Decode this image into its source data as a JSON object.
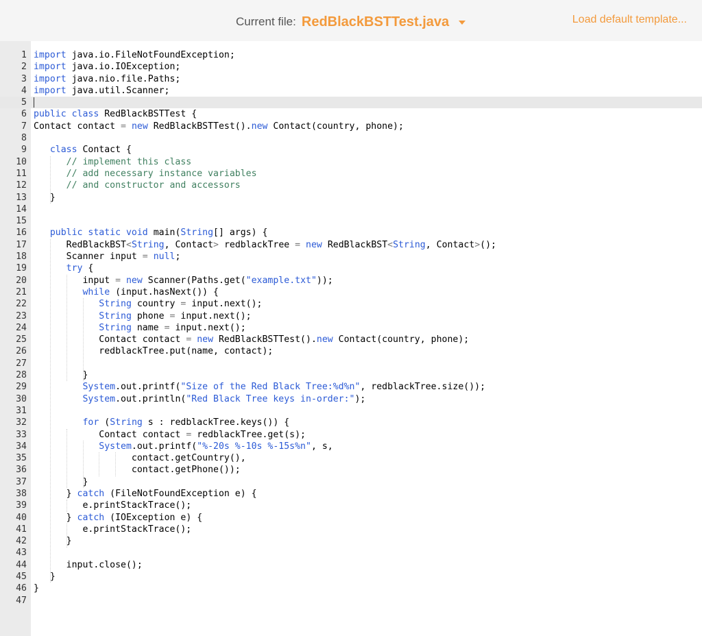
{
  "header": {
    "current_file_label": "Current file:",
    "current_file_name": "RedBlackBSTTest.java",
    "dropdown_icon": "caret-down-icon",
    "load_template_label": "Load default template...",
    "accent_color": "#f39a3c"
  },
  "editor": {
    "cursor_line": 5,
    "lines": [
      {
        "n": "1",
        "t": [
          [
            "kw",
            "import "
          ],
          [
            "",
            "java.io.FileNotFoundException;"
          ]
        ]
      },
      {
        "n": "2",
        "t": [
          [
            "kw",
            "import "
          ],
          [
            "",
            "java.io.IOException;"
          ]
        ]
      },
      {
        "n": "3",
        "t": [
          [
            "kw",
            "import "
          ],
          [
            "",
            "java.nio.file.Paths;"
          ]
        ]
      },
      {
        "n": "4",
        "t": [
          [
            "kw",
            "import "
          ],
          [
            "",
            "java.util.Scanner;"
          ]
        ]
      },
      {
        "n": "5",
        "t": []
      },
      {
        "n": "6",
        "t": [
          [
            "kw",
            "public class "
          ],
          [
            "",
            "RedBlackBSTTest {"
          ]
        ]
      },
      {
        "n": "7",
        "t": [
          [
            "",
            "Contact contact "
          ],
          [
            "op",
            "="
          ],
          [
            "kw",
            " new "
          ],
          [
            "",
            "RedBlackBSTTest()."
          ],
          [
            "kw",
            "new "
          ],
          [
            "",
            "Contact(country, phone);"
          ]
        ]
      },
      {
        "n": "8",
        "t": []
      },
      {
        "n": "9",
        "t": [
          [
            "",
            "   "
          ],
          [
            "kw",
            "class "
          ],
          [
            "",
            "Contact {"
          ]
        ]
      },
      {
        "n": "10",
        "t": [
          [
            "",
            "      "
          ],
          [
            "cm",
            "// implement this class"
          ]
        ]
      },
      {
        "n": "11",
        "t": [
          [
            "",
            "      "
          ],
          [
            "cm",
            "// add necessary instance variables"
          ]
        ]
      },
      {
        "n": "12",
        "t": [
          [
            "",
            "      "
          ],
          [
            "cm",
            "// and constructor and accessors"
          ]
        ]
      },
      {
        "n": "13",
        "t": [
          [
            "",
            "   }"
          ]
        ]
      },
      {
        "n": "14",
        "t": []
      },
      {
        "n": "15",
        "t": []
      },
      {
        "n": "16",
        "t": [
          [
            "",
            "   "
          ],
          [
            "kw",
            "public static void "
          ],
          [
            "",
            "main("
          ],
          [
            "kw",
            "String"
          ],
          [
            "",
            "[] args) {"
          ]
        ]
      },
      {
        "n": "17",
        "t": [
          [
            "",
            "      RedBlackBST"
          ],
          [
            "op",
            "<"
          ],
          [
            "kw",
            "String"
          ],
          [
            "",
            ", Contact"
          ],
          [
            "op",
            "> "
          ],
          [
            "",
            "redblackTree "
          ],
          [
            "op",
            "= "
          ],
          [
            "kw",
            "new "
          ],
          [
            "",
            "RedBlackBST"
          ],
          [
            "op",
            "<"
          ],
          [
            "kw",
            "String"
          ],
          [
            "",
            ", Contact"
          ],
          [
            "op",
            ">"
          ],
          [
            "",
            "();"
          ]
        ]
      },
      {
        "n": "18",
        "t": [
          [
            "",
            "      Scanner input "
          ],
          [
            "op",
            "= "
          ],
          [
            "kw",
            "null"
          ],
          [
            "",
            ";"
          ]
        ]
      },
      {
        "n": "19",
        "t": [
          [
            "",
            "      "
          ],
          [
            "kw",
            "try "
          ],
          [
            "",
            "{"
          ]
        ]
      },
      {
        "n": "20",
        "t": [
          [
            "",
            "         input "
          ],
          [
            "op",
            "= "
          ],
          [
            "kw",
            "new "
          ],
          [
            "",
            "Scanner(Paths.get("
          ],
          [
            "str",
            "\"example.txt\""
          ],
          [
            "",
            "));"
          ]
        ]
      },
      {
        "n": "21",
        "t": [
          [
            "",
            "         "
          ],
          [
            "kw",
            "while "
          ],
          [
            "",
            "(input.hasNext()) {"
          ]
        ]
      },
      {
        "n": "22",
        "t": [
          [
            "",
            "            "
          ],
          [
            "kw",
            "String "
          ],
          [
            "",
            "country "
          ],
          [
            "op",
            "= "
          ],
          [
            "",
            "input.next();"
          ]
        ]
      },
      {
        "n": "23",
        "t": [
          [
            "",
            "            "
          ],
          [
            "kw",
            "String "
          ],
          [
            "",
            "phone "
          ],
          [
            "op",
            "= "
          ],
          [
            "",
            "input.next();"
          ]
        ]
      },
      {
        "n": "24",
        "t": [
          [
            "",
            "            "
          ],
          [
            "kw",
            "String "
          ],
          [
            "",
            "name "
          ],
          [
            "op",
            "= "
          ],
          [
            "",
            "input.next();"
          ]
        ]
      },
      {
        "n": "25",
        "t": [
          [
            "",
            "            Contact contact "
          ],
          [
            "op",
            "= "
          ],
          [
            "kw",
            "new "
          ],
          [
            "",
            "RedBlackBSTTest()."
          ],
          [
            "kw",
            "new "
          ],
          [
            "",
            "Contact(country, phone);"
          ]
        ]
      },
      {
        "n": "26",
        "t": [
          [
            "",
            "            redblackTree.put(name, contact);"
          ]
        ]
      },
      {
        "n": "27",
        "t": []
      },
      {
        "n": "28",
        "t": [
          [
            "",
            "         }"
          ]
        ]
      },
      {
        "n": "29",
        "t": [
          [
            "",
            "         "
          ],
          [
            "kw",
            "System"
          ],
          [
            "",
            ".out.printf("
          ],
          [
            "str",
            "\"Size of the Red Black Tree:%d%n\""
          ],
          [
            "",
            ", redblackTree.size());"
          ]
        ]
      },
      {
        "n": "30",
        "t": [
          [
            "",
            "         "
          ],
          [
            "kw",
            "System"
          ],
          [
            "",
            ".out.println("
          ],
          [
            "str",
            "\"Red Black Tree keys in-order:\""
          ],
          [
            "",
            ");"
          ]
        ]
      },
      {
        "n": "31",
        "t": []
      },
      {
        "n": "32",
        "t": [
          [
            "",
            "         "
          ],
          [
            "kw",
            "for "
          ],
          [
            "",
            "("
          ],
          [
            "kw",
            "String "
          ],
          [
            "",
            "s : redblackTree.keys()) {"
          ]
        ]
      },
      {
        "n": "33",
        "t": [
          [
            "",
            "            Contact contact "
          ],
          [
            "op",
            "= "
          ],
          [
            "",
            "redblackTree.get(s);"
          ]
        ]
      },
      {
        "n": "34",
        "t": [
          [
            "",
            "            "
          ],
          [
            "kw",
            "System"
          ],
          [
            "",
            ".out.printf("
          ],
          [
            "str",
            "\"%-20s %-10s %-15s%n\""
          ],
          [
            "",
            ", s,"
          ]
        ]
      },
      {
        "n": "35",
        "t": [
          [
            "",
            "                  contact.getCountry(),"
          ]
        ]
      },
      {
        "n": "36",
        "t": [
          [
            "",
            "                  contact.getPhone());"
          ]
        ]
      },
      {
        "n": "37",
        "t": [
          [
            "",
            "         }"
          ]
        ]
      },
      {
        "n": "38",
        "t": [
          [
            "",
            "      } "
          ],
          [
            "kw",
            "catch "
          ],
          [
            "",
            "(FileNotFoundException e) {"
          ]
        ]
      },
      {
        "n": "39",
        "t": [
          [
            "",
            "         e.printStackTrace();"
          ]
        ]
      },
      {
        "n": "40",
        "t": [
          [
            "",
            "      } "
          ],
          [
            "kw",
            "catch "
          ],
          [
            "",
            "(IOException e) {"
          ]
        ]
      },
      {
        "n": "41",
        "t": [
          [
            "",
            "         e.printStackTrace();"
          ]
        ]
      },
      {
        "n": "42",
        "t": [
          [
            "",
            "      }"
          ]
        ]
      },
      {
        "n": "43",
        "t": []
      },
      {
        "n": "44",
        "t": [
          [
            "",
            "      input.close();"
          ]
        ]
      },
      {
        "n": "45",
        "t": [
          [
            "",
            "   }"
          ]
        ]
      },
      {
        "n": "46",
        "t": [
          [
            "",
            "}"
          ]
        ]
      },
      {
        "n": "47",
        "t": []
      }
    ]
  }
}
